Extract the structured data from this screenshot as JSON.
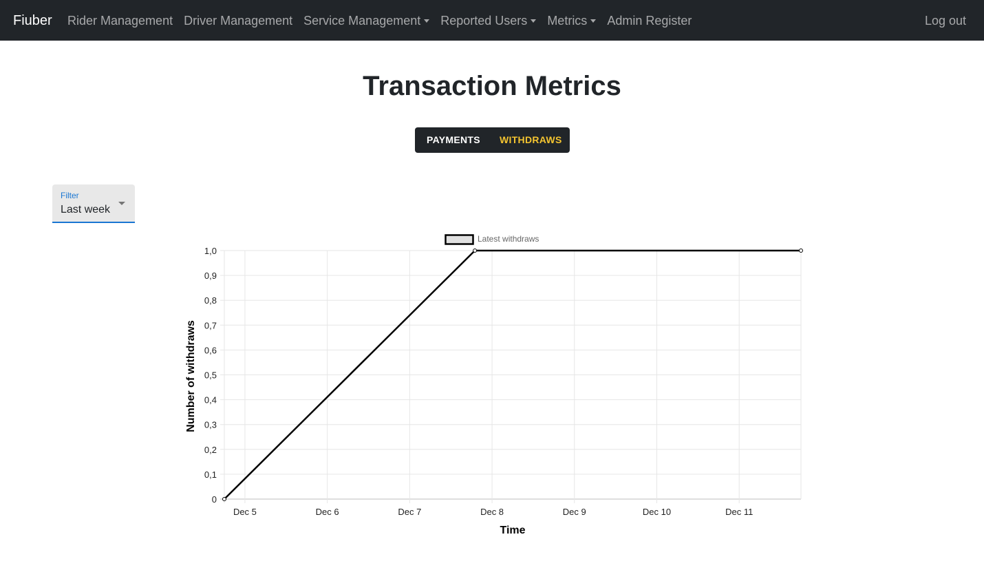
{
  "navbar": {
    "brand": "Fiuber",
    "items": [
      {
        "label": "Rider Management",
        "dropdown": false
      },
      {
        "label": "Driver Management",
        "dropdown": false
      },
      {
        "label": "Service Management",
        "dropdown": true
      },
      {
        "label": "Reported Users",
        "dropdown": true
      },
      {
        "label": "Metrics",
        "dropdown": true
      },
      {
        "label": "Admin Register",
        "dropdown": false
      }
    ],
    "logout": "Log out"
  },
  "page": {
    "title": "Transaction Metrics"
  },
  "toggle": {
    "payments": "Payments",
    "withdraws": "Withdraws",
    "active": "withdraws",
    "active_color": "#f4c430"
  },
  "filter": {
    "label": "Filter",
    "value": "Last week"
  },
  "colors": {
    "navbar_bg": "#212529",
    "accent": "#1976d2",
    "series": "#000000"
  },
  "chart_data": {
    "type": "line",
    "legend": {
      "entries": [
        "Latest withdraws"
      ],
      "placement": "top-center"
    },
    "xlabel": "Time",
    "ylabel": "Number of withdraws",
    "x_ticks": [
      "Dec 5",
      "Dec 6",
      "Dec 7",
      "Dec 8",
      "Dec 9",
      "Dec 10",
      "Dec 11"
    ],
    "y_ticks": [
      "0",
      "0,1",
      "0,2",
      "0,3",
      "0,4",
      "0,5",
      "0,6",
      "0,7",
      "0,8",
      "0,9",
      "1,0"
    ],
    "xlim": [
      "Dec 4 18:00",
      "Dec 11 18:00"
    ],
    "ylim": [
      0,
      1
    ],
    "grid": true,
    "series": [
      {
        "name": "Latest withdraws",
        "x": [
          "Dec 4 18:00",
          "Dec 7 19:00",
          "Dec 11 18:00"
        ],
        "y": [
          0,
          1,
          1
        ]
      }
    ]
  }
}
